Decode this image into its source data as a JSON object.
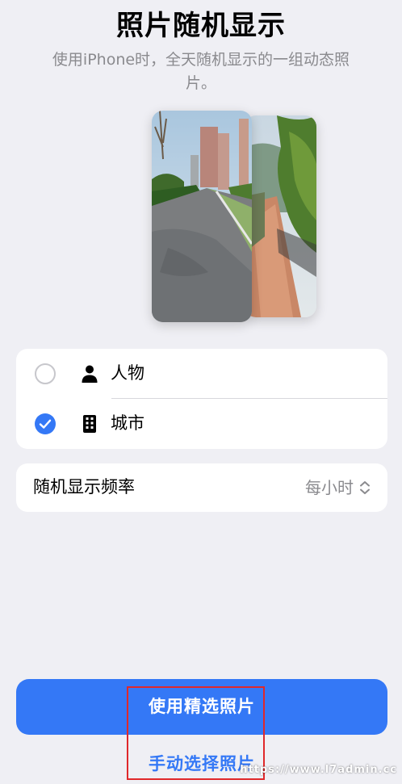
{
  "header": {
    "title": "照片随机显示",
    "subtitle": "使用iPhone时，全天随机显示的一组动态照片。"
  },
  "options": [
    {
      "label": "人物",
      "icon": "person-icon",
      "selected": false
    },
    {
      "label": "城市",
      "icon": "building-icon",
      "selected": true
    }
  ],
  "frequency": {
    "label": "随机显示频率",
    "value": "每小时",
    "icon": "chevron-up-down-icon"
  },
  "actions": {
    "primary_label": "使用精选照片",
    "secondary_label": "手动选择照片"
  },
  "watermark": "https://www.l7admin.cc",
  "colors": {
    "accent": "#3478f6",
    "background": "#efeff4",
    "card": "#ffffff",
    "secondary_text": "#8a8a8e",
    "highlight_border": "#e0282a"
  }
}
